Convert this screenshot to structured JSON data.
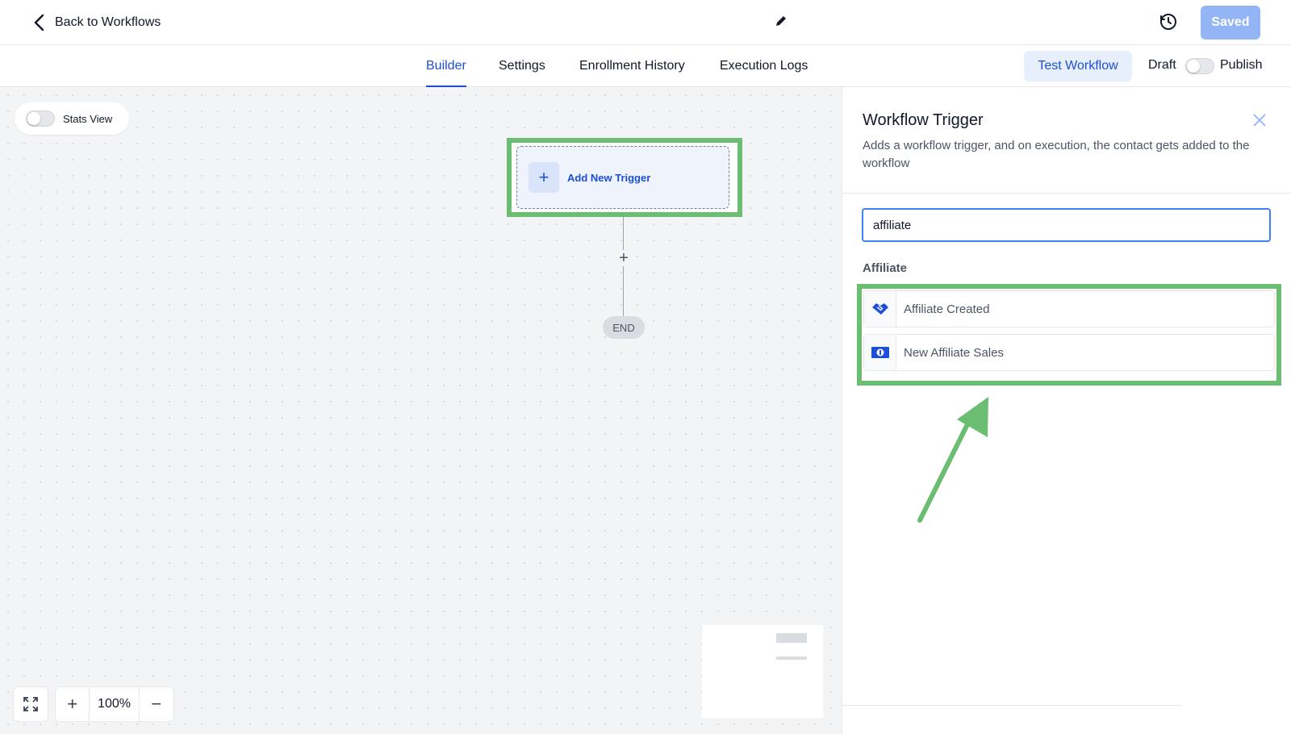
{
  "header": {
    "back_label": "Back to Workflows",
    "saved_label": "Saved"
  },
  "tabs": {
    "builder": "Builder",
    "settings": "Settings",
    "enrollment_history": "Enrollment History",
    "execution_logs": "Execution Logs",
    "active": "Builder"
  },
  "actions": {
    "test_workflow": "Test Workflow",
    "draft_label": "Draft",
    "publish_label": "Publish"
  },
  "canvas": {
    "stats_view_label": "Stats View",
    "add_trigger_label": "Add New Trigger",
    "add_step_symbol": "+",
    "end_label": "END",
    "zoom_level": "100%",
    "zoom_in_symbol": "+",
    "zoom_out_symbol": "−"
  },
  "panel": {
    "title": "Workflow Trigger",
    "description": "Adds a workflow trigger, and on execution, the contact gets added to the workflow",
    "search_value": "affiliate",
    "group_title": "Affiliate",
    "results": [
      {
        "label": "Affiliate Created",
        "icon": "handshake-icon"
      },
      {
        "label": "New Affiliate Sales",
        "icon": "money-icon"
      }
    ]
  },
  "colors": {
    "accent": "#1d4ed8",
    "highlight": "#6bbd72",
    "saved_button": "#93b4f5"
  }
}
